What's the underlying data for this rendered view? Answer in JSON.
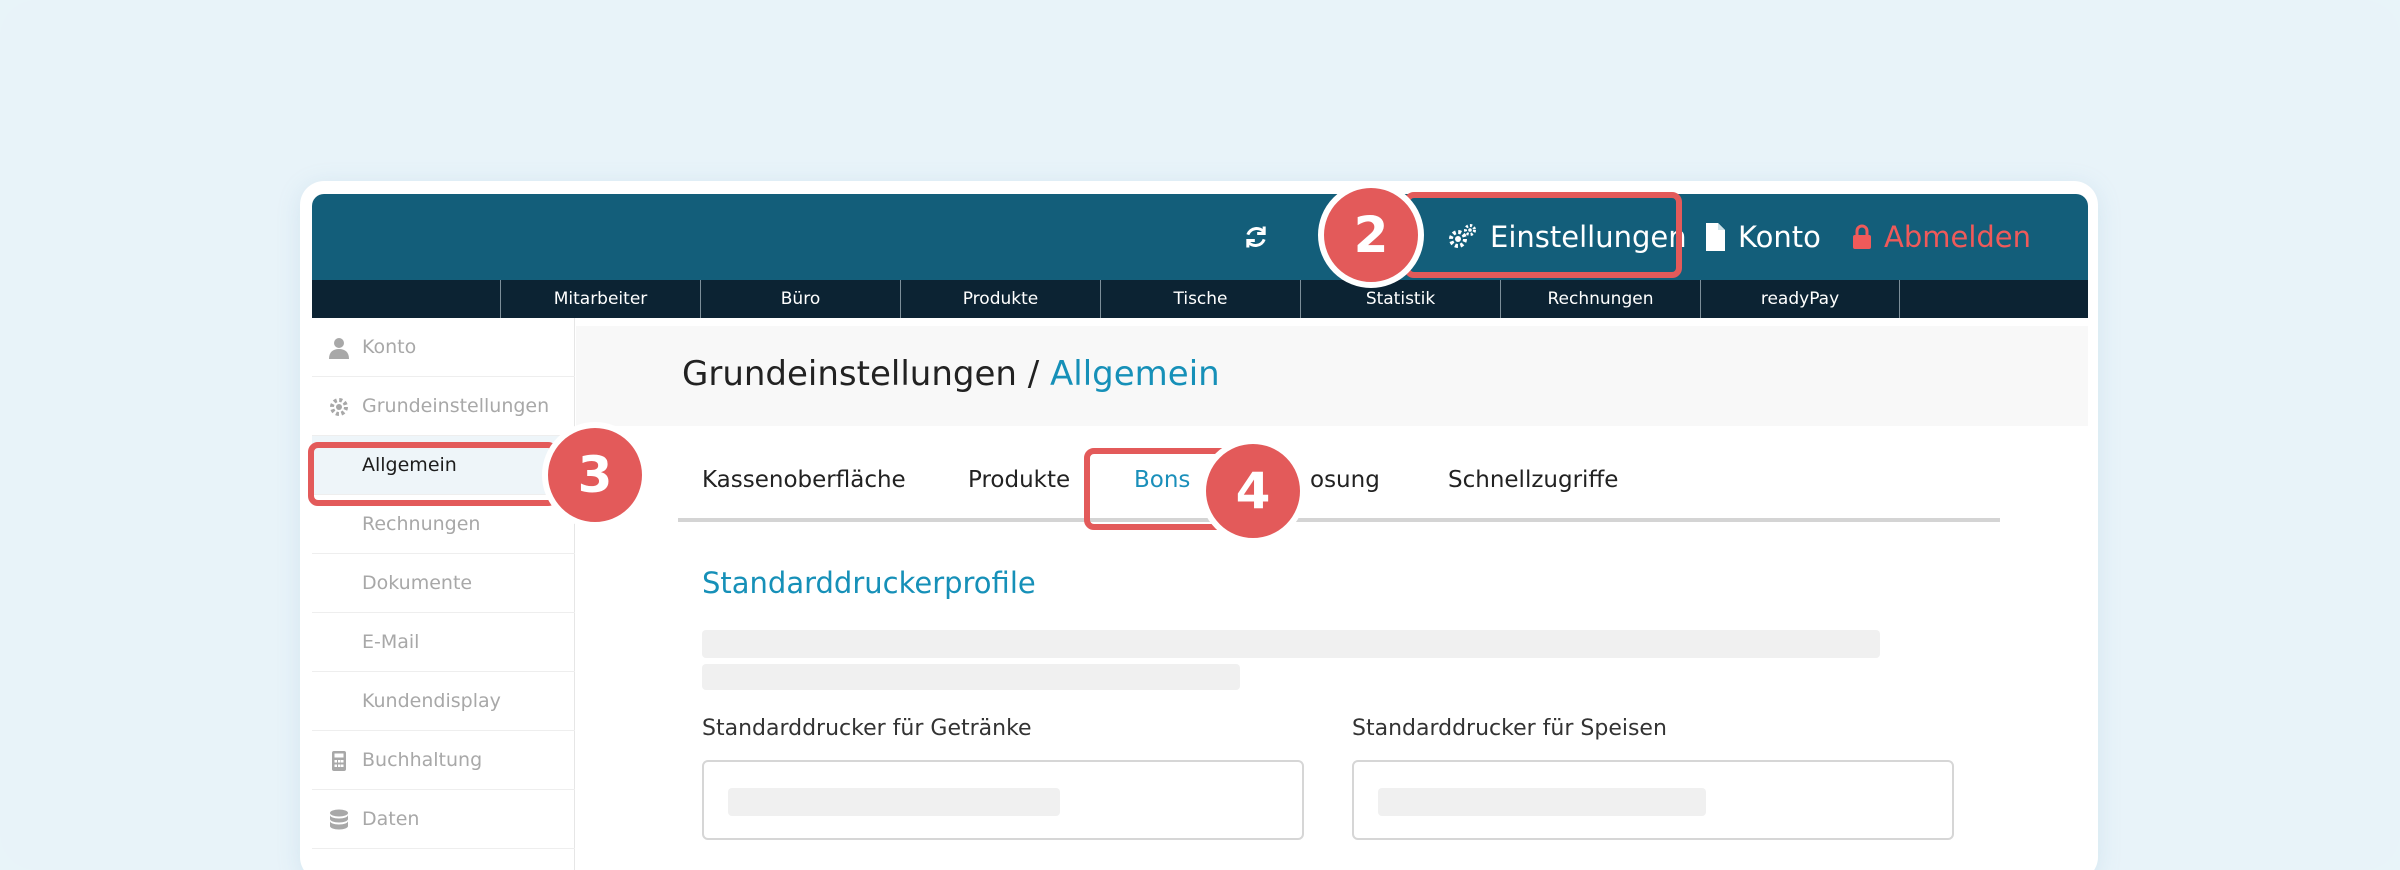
{
  "topbar": {
    "refresh_icon": "refresh-icon",
    "settings_label": "Einstellungen",
    "settings_icon": "gears-icon",
    "account_label": "Konto",
    "account_icon": "document-icon",
    "logout_label": "Abmelden",
    "logout_icon": "lock-icon"
  },
  "subnav": {
    "tabs": [
      "Mitarbeiter",
      "Büro",
      "Produkte",
      "Tische",
      "Statistik",
      "Rechnungen",
      "readyPay"
    ]
  },
  "sidebar": {
    "items": [
      {
        "label": "Konto",
        "icon": "user-icon"
      },
      {
        "label": "Grundeinstellungen",
        "icon": "gear-icon"
      },
      {
        "label": "Allgemein"
      },
      {
        "label": "Rechnungen"
      },
      {
        "label": "Dokumente"
      },
      {
        "label": "E-Mail"
      },
      {
        "label": "Kundendisplay"
      },
      {
        "label": "Buchhaltung",
        "icon": "calculator-icon"
      },
      {
        "label": "Daten",
        "icon": "database-icon"
      }
    ]
  },
  "main": {
    "title_prefix": "Grundeinstellungen / ",
    "title_accent": "Allgemein",
    "tabs": [
      "Kassenoberfläche",
      "Produkte",
      "Bons",
      "osung",
      "Schnellzugriffe"
    ],
    "section_title": "Standarddruckerprofile",
    "field_drinks_label": "Standarddrucker für Getränke",
    "field_food_label": "Standarddrucker für Speisen"
  },
  "callouts": [
    "2",
    "3",
    "4"
  ],
  "colors": {
    "header": "#135e7a",
    "subnav": "#0c2333",
    "accent": "#1690b8",
    "callout": "#e35a5a",
    "logout": "#ef5a5a"
  }
}
